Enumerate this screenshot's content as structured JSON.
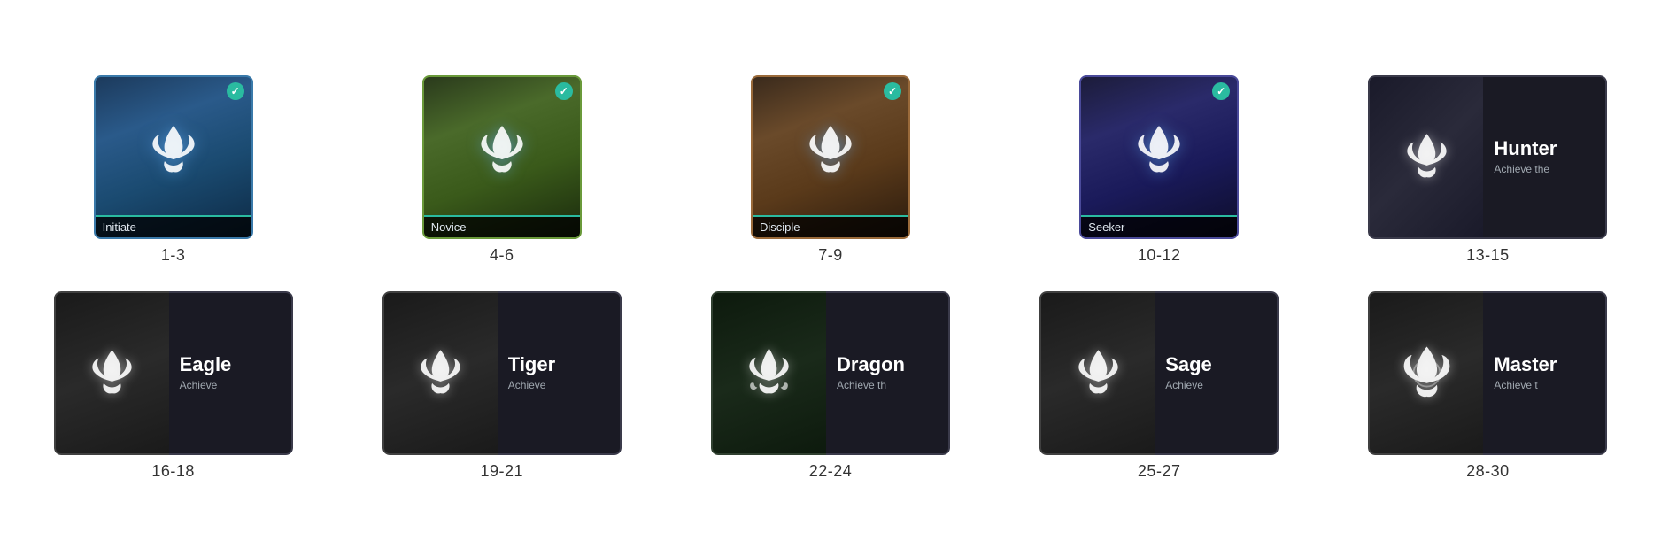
{
  "ranks": [
    {
      "id": "initiate",
      "name": "Initiate",
      "range": "1-3",
      "type": "single",
      "completed": true,
      "row": 1
    },
    {
      "id": "novice",
      "name": "Novice",
      "range": "4-6",
      "type": "single",
      "completed": true,
      "row": 1
    },
    {
      "id": "disciple",
      "name": "Disciple",
      "range": "7-9",
      "type": "single",
      "completed": true,
      "row": 1
    },
    {
      "id": "seeker",
      "name": "Seeker",
      "range": "10-12",
      "type": "single",
      "completed": true,
      "row": 1
    },
    {
      "id": "hunter",
      "name": "Hunter",
      "range": "13-15",
      "type": "wide",
      "completed": false,
      "description": "Achieve the",
      "row": 1
    },
    {
      "id": "eagle",
      "name": "Eagle",
      "range": "16-18",
      "type": "wide",
      "completed": false,
      "description": "Achieve",
      "row": 2
    },
    {
      "id": "tiger",
      "name": "Tiger",
      "range": "19-21",
      "type": "wide",
      "completed": false,
      "description": "Achieve",
      "row": 2
    },
    {
      "id": "dragon",
      "name": "Dragon",
      "range": "22-24",
      "type": "wide",
      "completed": false,
      "description": "Achieve th",
      "row": 2
    },
    {
      "id": "sage",
      "name": "Sage",
      "range": "25-27",
      "type": "wide",
      "completed": false,
      "description": "Achieve",
      "row": 2
    },
    {
      "id": "master",
      "name": "Master",
      "range": "28-30",
      "type": "wide",
      "completed": false,
      "description": "Achieve t",
      "row": 2
    }
  ]
}
